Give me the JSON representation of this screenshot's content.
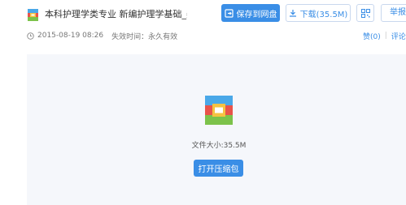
{
  "header": {
    "title": "本科护理学类专业 新编护理学基础_姜安...",
    "save_label": "保存到网盘",
    "download_label": "下载(35.5M)",
    "report_label": "举报"
  },
  "meta": {
    "date": "2015-08-19 08:26",
    "expiry": "失效时间：永久有效",
    "like": "赞(0)",
    "comment": "评论("
  },
  "preview": {
    "file_size": "文件大小:35.5M",
    "open_label": "打开压缩包"
  },
  "colors": {
    "accent": "#3a8ee6",
    "panel_bg": "#f5f7fb"
  },
  "icons": [
    "archive-file-icon",
    "cloud-save-icon",
    "download-icon",
    "qr-code-icon",
    "clock-icon"
  ]
}
